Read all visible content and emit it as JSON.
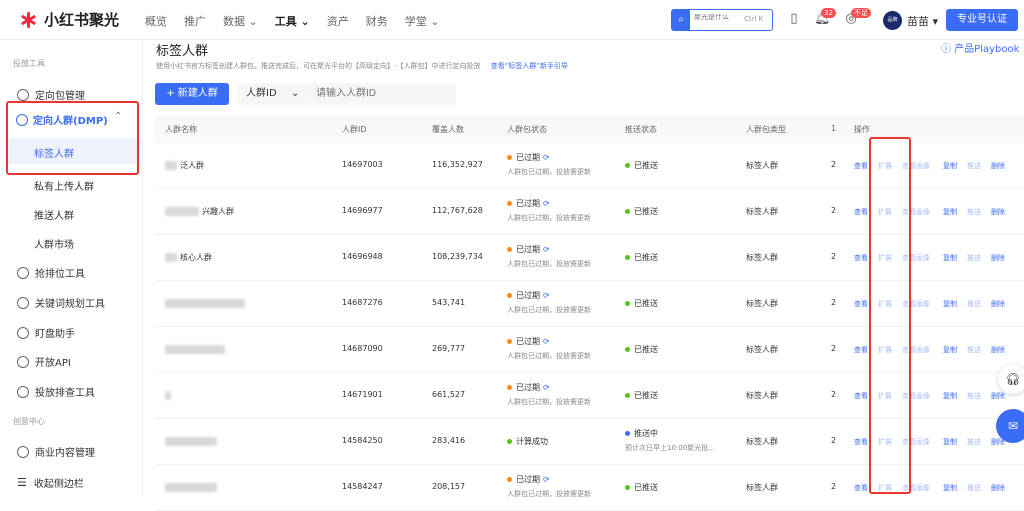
{
  "app": {
    "brand": "小红书聚光"
  },
  "topnav": [
    "概览",
    "推广",
    "数据",
    "工具",
    "资产",
    "财务",
    "学堂"
  ],
  "topnav_active": 3,
  "search": {
    "placeholder": "聚光是什么",
    "shortcut": "Ctrl K"
  },
  "header": {
    "notify_count": "32",
    "status_badge": "不足",
    "avatar_text": "品牌",
    "username": "苗苗",
    "certify_label": "专业号认证"
  },
  "sidebar": {
    "section1": "投放工具",
    "item_pkg": "定向包管理",
    "group_label": "定向人群(DMP)",
    "sub_active": "标签人群",
    "sub_items": [
      "私有上传人群",
      "推送人群",
      "人群市场"
    ],
    "tools": [
      "抢排位工具",
      "关键词规划工具",
      "盯盘助手",
      "开放API",
      "投放排查工具"
    ],
    "section2": "创意中心",
    "item_content": "商业内容管理",
    "collapse": "收起侧边栏"
  },
  "page": {
    "title": "标签人群",
    "desc": "使用小红书官方标签创建人群包，推送完成后，可在聚光平台的【高级定向】-【人群包】中进行定向投放",
    "guide_link": "查看“标签人群”新手引导",
    "playbook": "产品Playbook",
    "new_button": "+ 新建人群",
    "filter_field": "人群ID",
    "filter_placeholder": "请输入人群ID"
  },
  "table": {
    "headers": [
      "人群名称",
      "人群ID",
      "覆盖人数",
      "人群包状态",
      "推送状态",
      "人群包类型",
      "1",
      "操作"
    ],
    "actions": [
      "查看",
      "扩展",
      "查看画像",
      "复制",
      "推送",
      "删除"
    ],
    "rows": [
      {
        "name": "泛人群",
        "id": "14697003",
        "count": "116,352,927",
        "status": "已过期",
        "status_sub": "人群包已过期，投放需更新",
        "push": "已推送",
        "push_sub": "",
        "type": "标签人群",
        "col7": "2"
      },
      {
        "name": "兴趣人群",
        "id": "14696977",
        "count": "112,767,628",
        "status": "已过期",
        "status_sub": "人群包已过期，投放需更新",
        "push": "已推送",
        "push_sub": "",
        "type": "标签人群",
        "col7": "2"
      },
      {
        "name": "核心人群",
        "id": "14696948",
        "count": "108,239,734",
        "status": "已过期",
        "status_sub": "人群包已过期，投放需更新",
        "push": "已推送",
        "push_sub": "",
        "type": "标签人群",
        "col7": "2"
      },
      {
        "name": "",
        "id": "14687276",
        "count": "543,741",
        "status": "已过期",
        "status_sub": "人群包已过期，投放需更新",
        "push": "已推送",
        "push_sub": "",
        "type": "标签人群",
        "col7": "2"
      },
      {
        "name": "",
        "id": "14687090",
        "count": "269,777",
        "status": "已过期",
        "status_sub": "人群包已过期，投放需更新",
        "push": "已推送",
        "push_sub": "",
        "type": "标签人群",
        "col7": "2"
      },
      {
        "name": "",
        "id": "14671901",
        "count": "661,527",
        "status": "已过期",
        "status_sub": "人群包已过期，投放需更新",
        "push": "已推送",
        "push_sub": "",
        "type": "标签人群",
        "col7": "2"
      },
      {
        "name": "",
        "id": "14584250",
        "count": "283,416",
        "status": "计算成功",
        "status_sub": "",
        "push": "推送中",
        "push_sub": "预计次日早上10:00聚光投...",
        "type": "标签人群",
        "col7": "2"
      },
      {
        "name": "",
        "id": "14584247",
        "count": "208,157",
        "status": "已过期",
        "status_sub": "人群包已过期，投放需更新",
        "push": "已推送",
        "push_sub": "",
        "type": "标签人群",
        "col7": "2"
      }
    ]
  },
  "colors": {
    "accent": "#3b6cf6",
    "highlight_box": "#e8372c",
    "expired": "#fa8c16",
    "success": "#52c41a"
  }
}
